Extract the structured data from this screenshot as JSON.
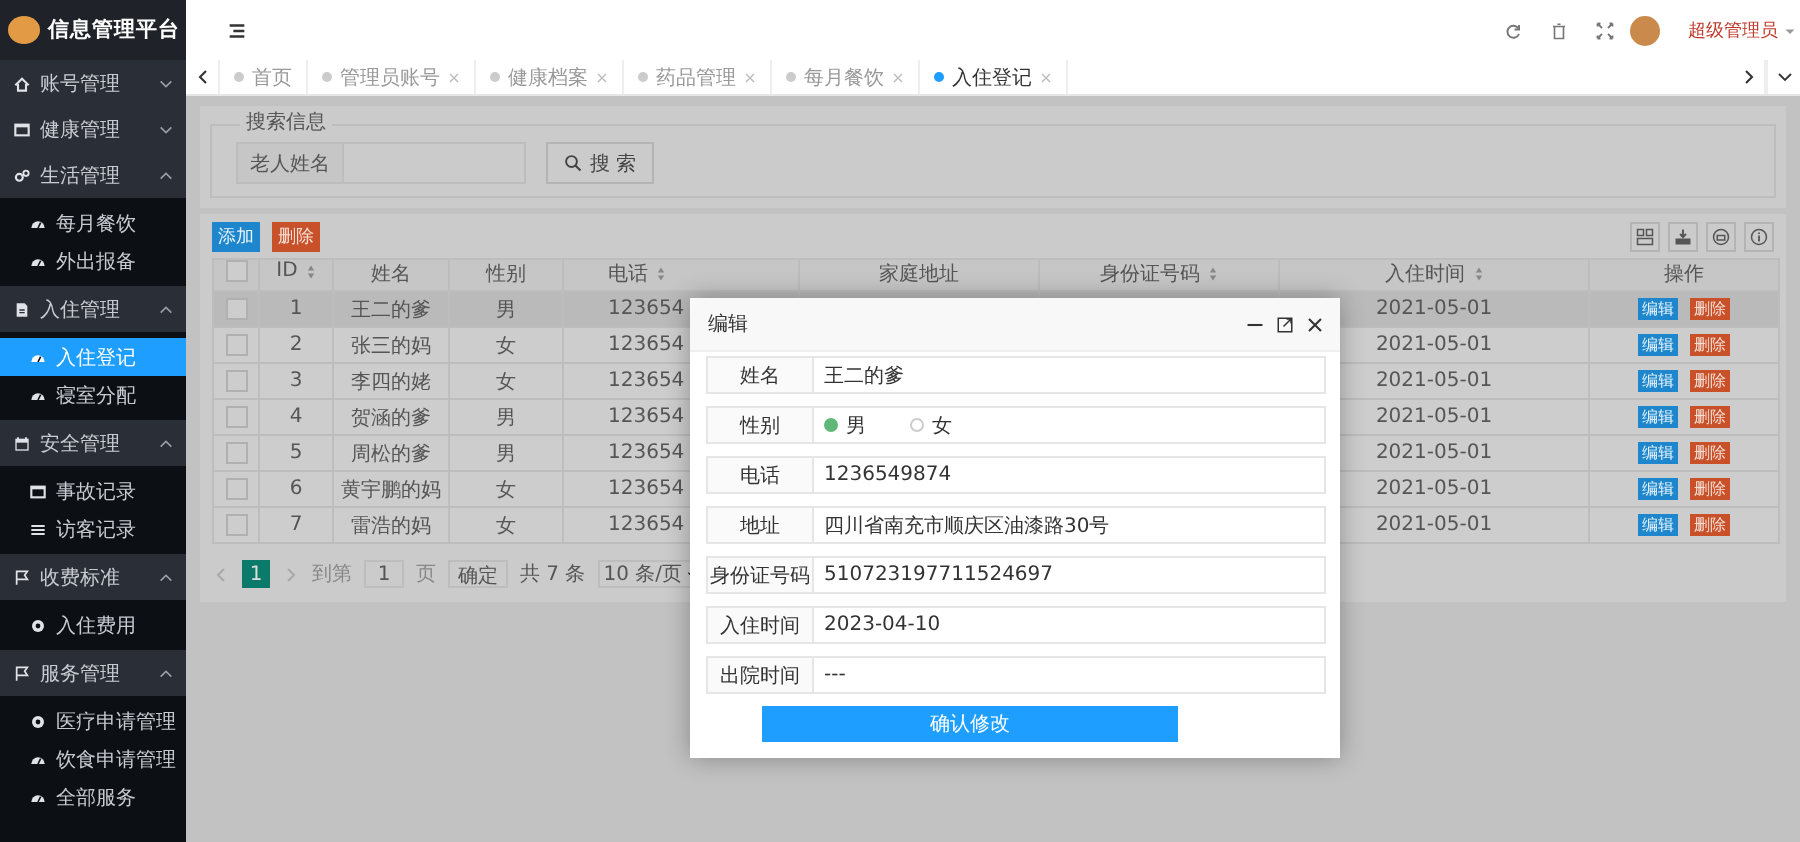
{
  "logo": {
    "title": "信息管理平台"
  },
  "header": {
    "user": "超级管理员"
  },
  "tabs": [
    {
      "label": "首页",
      "selected": false,
      "closable": false
    },
    {
      "label": "管理员账号",
      "selected": false,
      "closable": true
    },
    {
      "label": "健康档案",
      "selected": false,
      "closable": true
    },
    {
      "label": "药品管理",
      "selected": false,
      "closable": true
    },
    {
      "label": "每月餐饮",
      "selected": false,
      "closable": true
    },
    {
      "label": "入住登记",
      "selected": true,
      "closable": true
    }
  ],
  "sidebar": {
    "groups": [
      {
        "label": "账号管理",
        "expanded": false
      },
      {
        "label": "健康管理",
        "expanded": false
      },
      {
        "label": "生活管理",
        "expanded": true,
        "children": [
          {
            "label": "每月餐饮",
            "selected": false
          },
          {
            "label": "外出报备",
            "selected": false
          }
        ]
      },
      {
        "label": "入住管理",
        "expanded": true,
        "children": [
          {
            "label": "入住登记",
            "selected": true
          },
          {
            "label": "寝室分配",
            "selected": false
          }
        ]
      },
      {
        "label": "安全管理",
        "expanded": true,
        "children": [
          {
            "label": "事故记录",
            "selected": false
          },
          {
            "label": "访客记录",
            "selected": false
          }
        ]
      },
      {
        "label": "收费标准",
        "expanded": true,
        "children": [
          {
            "label": "入住费用",
            "selected": false
          }
        ]
      },
      {
        "label": "服务管理",
        "expanded": true,
        "children": [
          {
            "label": "医疗申请管理",
            "selected": false
          },
          {
            "label": "饮食申请管理",
            "selected": false
          },
          {
            "label": "全部服务",
            "selected": false
          }
        ]
      }
    ]
  },
  "search": {
    "legend": "搜索信息",
    "field_label": "老人姓名",
    "button": "搜 索"
  },
  "toolbar": {
    "buttons": [
      {
        "label": "添加",
        "kind": "primary"
      },
      {
        "label": "删除",
        "kind": "danger"
      }
    ]
  },
  "table": {
    "select_all_checked": false,
    "columns": [
      {
        "label": "ID",
        "sortable": true
      },
      {
        "label": "姓名",
        "sortable": false
      },
      {
        "label": "性别",
        "sortable": false
      },
      {
        "label": "电话",
        "sortable": true
      },
      {
        "label": "家庭地址",
        "sortable": false
      },
      {
        "label": "身份证号码",
        "sortable": true
      },
      {
        "label": "入住时间",
        "sortable": true
      },
      {
        "label": "操作",
        "sortable": false
      }
    ],
    "rows": [
      {
        "checked": false,
        "highlighted": true,
        "cells": [
          "1",
          "王二的爹",
          "男",
          "123654"
        ],
        "checkin": "2021-05-01",
        "actions": [
          "编辑",
          "删除"
        ]
      },
      {
        "checked": false,
        "highlighted": false,
        "cells": [
          "2",
          "张三的妈",
          "女",
          "123654"
        ],
        "checkin": "2021-05-01",
        "actions": [
          "编辑",
          "删除"
        ]
      },
      {
        "checked": false,
        "highlighted": false,
        "cells": [
          "3",
          "李四的姥",
          "女",
          "123654"
        ],
        "checkin": "2021-05-01",
        "actions": [
          "编辑",
          "删除"
        ]
      },
      {
        "checked": false,
        "highlighted": false,
        "cells": [
          "4",
          "贺涵的爹",
          "男",
          "123654"
        ],
        "checkin": "2021-05-01",
        "actions": [
          "编辑",
          "删除"
        ]
      },
      {
        "checked": false,
        "highlighted": false,
        "cells": [
          "5",
          "周松的爹",
          "男",
          "123654"
        ],
        "checkin": "2021-05-01",
        "actions": [
          "编辑",
          "删除"
        ]
      },
      {
        "checked": false,
        "highlighted": false,
        "cells": [
          "6",
          "黄宇鹏的妈",
          "女",
          "123654"
        ],
        "checkin": "2021-05-01",
        "actions": [
          "编辑",
          "删除"
        ]
      },
      {
        "checked": false,
        "highlighted": false,
        "cells": [
          "7",
          "雷浩的妈",
          "女",
          "123654"
        ],
        "checkin": "2021-05-01",
        "actions": [
          "编辑",
          "删除"
        ]
      }
    ]
  },
  "pagination": {
    "pages": [
      {
        "label": "1",
        "selected": true
      }
    ],
    "goto_label": "到第",
    "goto_value": "1",
    "page_unit": "页",
    "confirm": "确定",
    "total": "共 7 条",
    "page_size": "10 条/页"
  },
  "modal": {
    "title": "编辑",
    "fields": [
      {
        "label": "姓名",
        "kind": "text",
        "value": "王二的爹"
      },
      {
        "label": "性别",
        "kind": "radio",
        "options": [
          {
            "label": "男",
            "selected": true
          },
          {
            "label": "女",
            "selected": false
          }
        ]
      },
      {
        "label": "电话",
        "kind": "text",
        "value": "1236549874"
      },
      {
        "label": "地址",
        "kind": "text",
        "value": "四川省南充市顺庆区油漆路30号"
      },
      {
        "label": "身份证号码",
        "kind": "text",
        "value": "510723197711524697"
      },
      {
        "label": "入住时间",
        "kind": "text",
        "value": "2023-04-10"
      },
      {
        "label": "出院时间",
        "kind": "text",
        "value": "---"
      }
    ],
    "submit": "确认修改"
  }
}
